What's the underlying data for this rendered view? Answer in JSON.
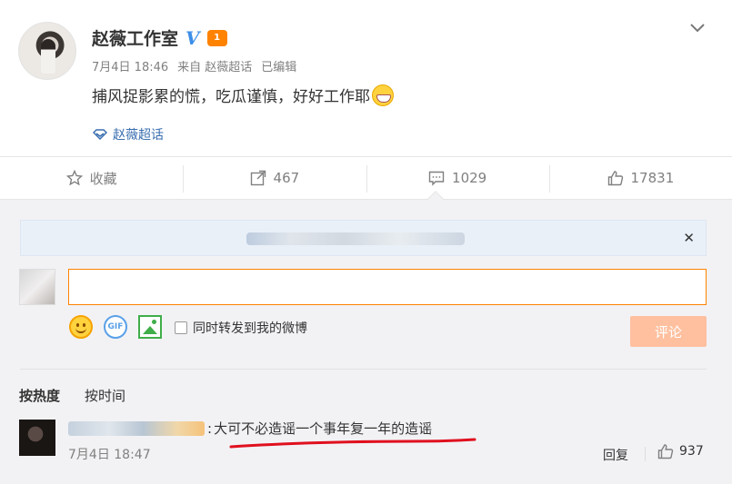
{
  "post": {
    "author": "赵薇工作室",
    "verified_badge": "V",
    "vip_badge": "1",
    "date": "7月4日 18:46",
    "source": "来自 赵薇超话",
    "edited": "已编辑",
    "text": "捕风捉影累的慌，吃瓜谨慎，好好工作耶",
    "topic": "赵薇超话"
  },
  "actions": {
    "favorite_label": "收藏",
    "repost_count": "467",
    "comment_count": "1029",
    "like_count": "17831"
  },
  "composer": {
    "input_value": "",
    "repost_label": "同时转发到我的微博",
    "submit_label": "评论",
    "gif_label": "GIF"
  },
  "sort": {
    "hot_label": "按热度",
    "time_label": "按时间"
  },
  "comments": [
    {
      "text": "大可不必造谣一个事年复一年的造谣",
      "date": "7月4日 18:47",
      "reply_label": "回复",
      "like_count": "937"
    }
  ],
  "colors": {
    "accent_orange": "#ff8200",
    "link_blue": "#3a6fb0",
    "annotation_red": "#e0101e",
    "submit_disabled": "#ffc09f"
  },
  "icons": [
    "chevron-down-icon",
    "topic-diamond-icon",
    "star-icon",
    "share-icon",
    "comment-icon",
    "thumb-up-icon",
    "close-icon",
    "emoji-icon",
    "gif-icon",
    "image-icon"
  ]
}
